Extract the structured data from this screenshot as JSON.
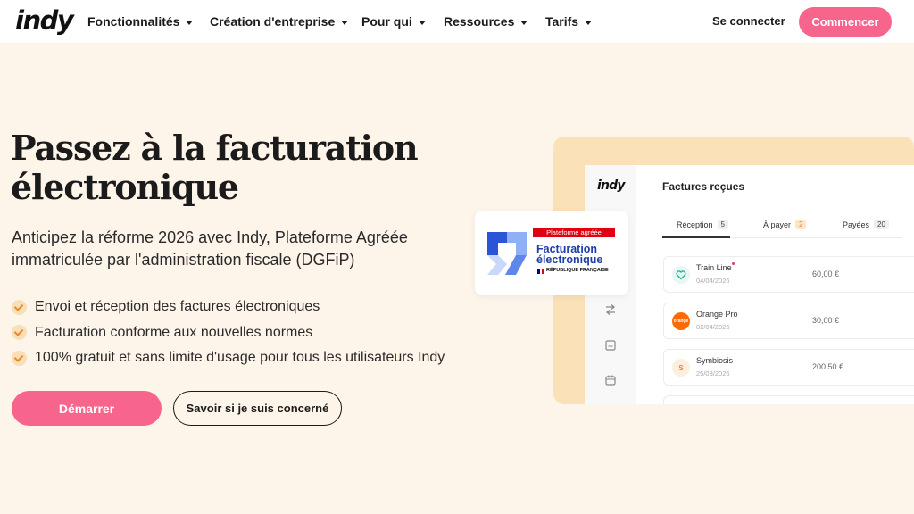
{
  "nav": {
    "logo": "indy",
    "items": [
      {
        "label": "Fonctionnalités"
      },
      {
        "label": "Création d'entreprise"
      },
      {
        "label": "Pour qui"
      },
      {
        "label": "Ressources"
      },
      {
        "label": "Tarifs"
      }
    ],
    "login_label": "Se connecter",
    "cta_label": "Commencer"
  },
  "hero": {
    "title_line1": "Passez à la facturation",
    "title_line2": "électronique",
    "subtitle_line1": "Anticipez la réforme 2026 avec Indy, Plateforme Agréée",
    "subtitle_line2": "immatriculée par l'administration fiscale (DGFiP)",
    "features": [
      "Envoi et réception des factures électroniques",
      "Facturation conforme aux nouvelles normes",
      "100% gratuit et sans limite d'usage pour tous les utilisateurs Indy"
    ],
    "primary_label": "Démarrer",
    "secondary_label": "Savoir si je suis concerné"
  },
  "badge": {
    "tag": "Plateforme agréée",
    "line1": "Facturation",
    "line2": "électronique",
    "republic": "RÉPUBLIQUE FRANÇAISE"
  },
  "mockup": {
    "logo": "indy",
    "title": "Factures reçues",
    "tabs": [
      {
        "label": "Réception",
        "count": "5"
      },
      {
        "label": "À payer",
        "count": "2"
      },
      {
        "label": "Payées",
        "count": "20"
      }
    ],
    "invoices": [
      {
        "name": "Train Line",
        "date": "04/04/2026",
        "amount": "60,00 €"
      },
      {
        "name": "Orange Pro",
        "date": "02/04/2026",
        "amount": "30,00 €",
        "icon_text": "orange"
      },
      {
        "name": "Symbiosis",
        "date": "25/03/2026",
        "amount": "200,50 €",
        "icon_text": "S"
      }
    ]
  },
  "colors": {
    "background": "#fdf5ea",
    "accent_pink": "#f7648c",
    "check_orange": "#e58a2f",
    "frame_peach": "#fbe1b8",
    "badge_blue": "#1e3ea8",
    "badge_red": "#e1000f"
  }
}
